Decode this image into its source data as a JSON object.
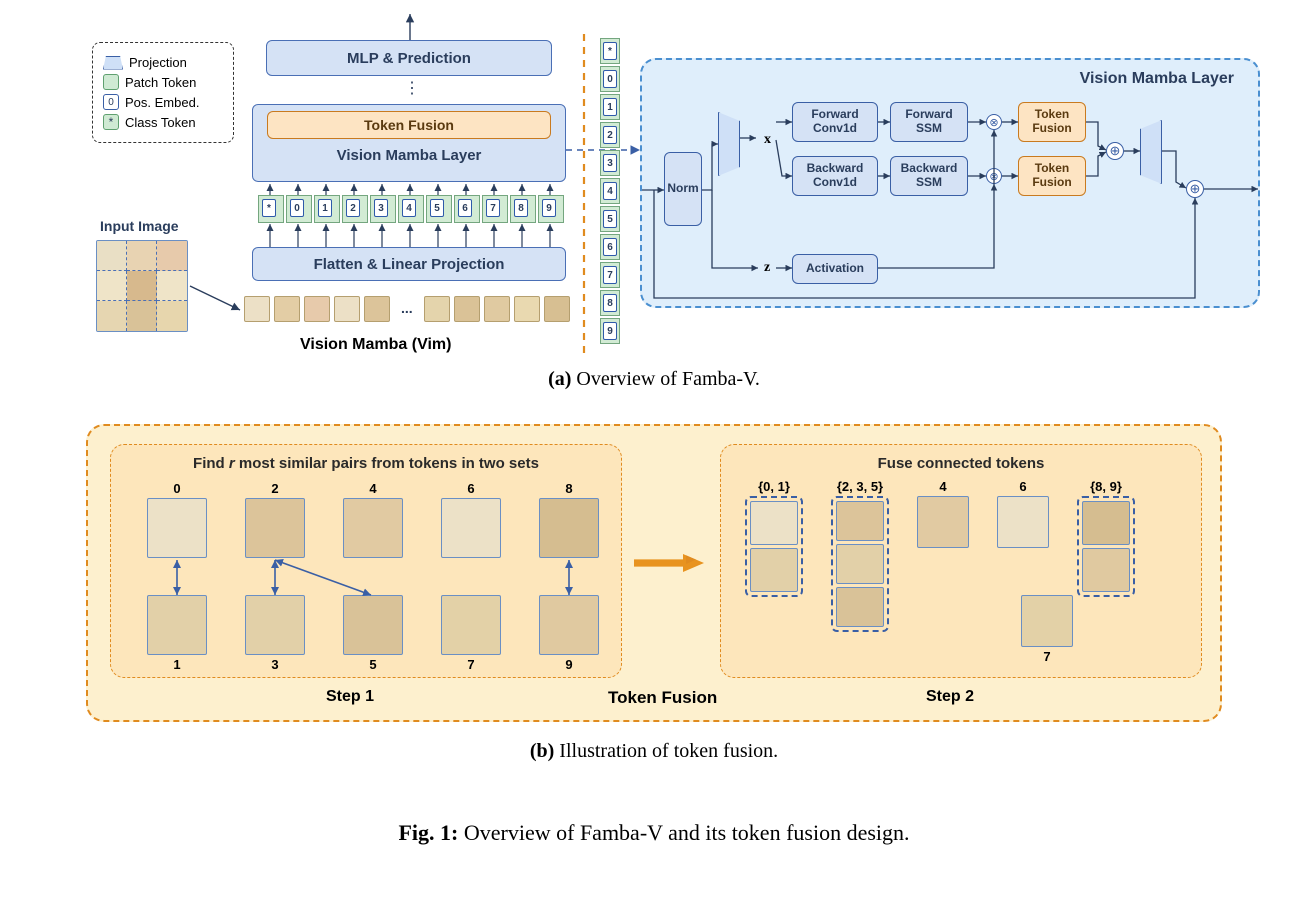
{
  "legend": {
    "projection": "Projection",
    "patch_token": "Patch Token",
    "pos_embed": "Pos. Embed.",
    "class_token": "Class Token"
  },
  "panel_a": {
    "input_image_label": "Input Image",
    "title": "Vision Mamba (Vim)",
    "mlp_pred": "MLP & Prediction",
    "token_fusion": "Token Fusion",
    "vml": "Vision Mamba Layer",
    "flatten": "Flatten & Linear Projection",
    "ellipsis": "⋮",
    "patch_ellipsis": "...",
    "token_ids": [
      "*",
      "0",
      "1",
      "2",
      "3",
      "4",
      "5",
      "6",
      "7",
      "8",
      "9"
    ],
    "vert_token_ids": [
      "*",
      "0",
      "1",
      "2",
      "3",
      "4",
      "5",
      "6",
      "7",
      "8",
      "9"
    ]
  },
  "vml": {
    "title": "Vision Mamba Layer",
    "norm": "Norm",
    "x": "x",
    "z": "z",
    "fw_conv": "Forward\nConv1d",
    "bw_conv": "Backward\nConv1d",
    "fw_ssm": "Forward\nSSM",
    "bw_ssm": "Backward\nSSM",
    "activation": "Activation",
    "token_fusion": "Token\nFusion"
  },
  "panel_b": {
    "title": "Token Fusion",
    "step1_title": "Find r most similar pairs from tokens in two sets",
    "step2_title": "Fuse connected tokens",
    "step1_label": "Step 1",
    "step2_label": "Step 2",
    "top_ids": [
      "0",
      "2",
      "4",
      "6",
      "8"
    ],
    "bot_ids": [
      "1",
      "3",
      "5",
      "7",
      "9"
    ],
    "groups": [
      "{0, 1}",
      "{2, 3, 5}",
      "4",
      "6",
      "{8, 9}"
    ],
    "lone": "7",
    "r_letter": "r"
  },
  "captions": {
    "a_label": "(a)",
    "a_text": "Overview of Famba-V.",
    "b_label": "(b)",
    "b_text": "Illustration of token fusion.",
    "fig_label": "Fig. 1:",
    "fig_text": "Overview of Famba-V and its token fusion design."
  },
  "colors": {
    "blue": "#4a6fb5",
    "blue_fill": "#d5e2f5",
    "orange": "#e08b1f",
    "orange_fill": "#fde4c3",
    "green": "#74a67f"
  }
}
